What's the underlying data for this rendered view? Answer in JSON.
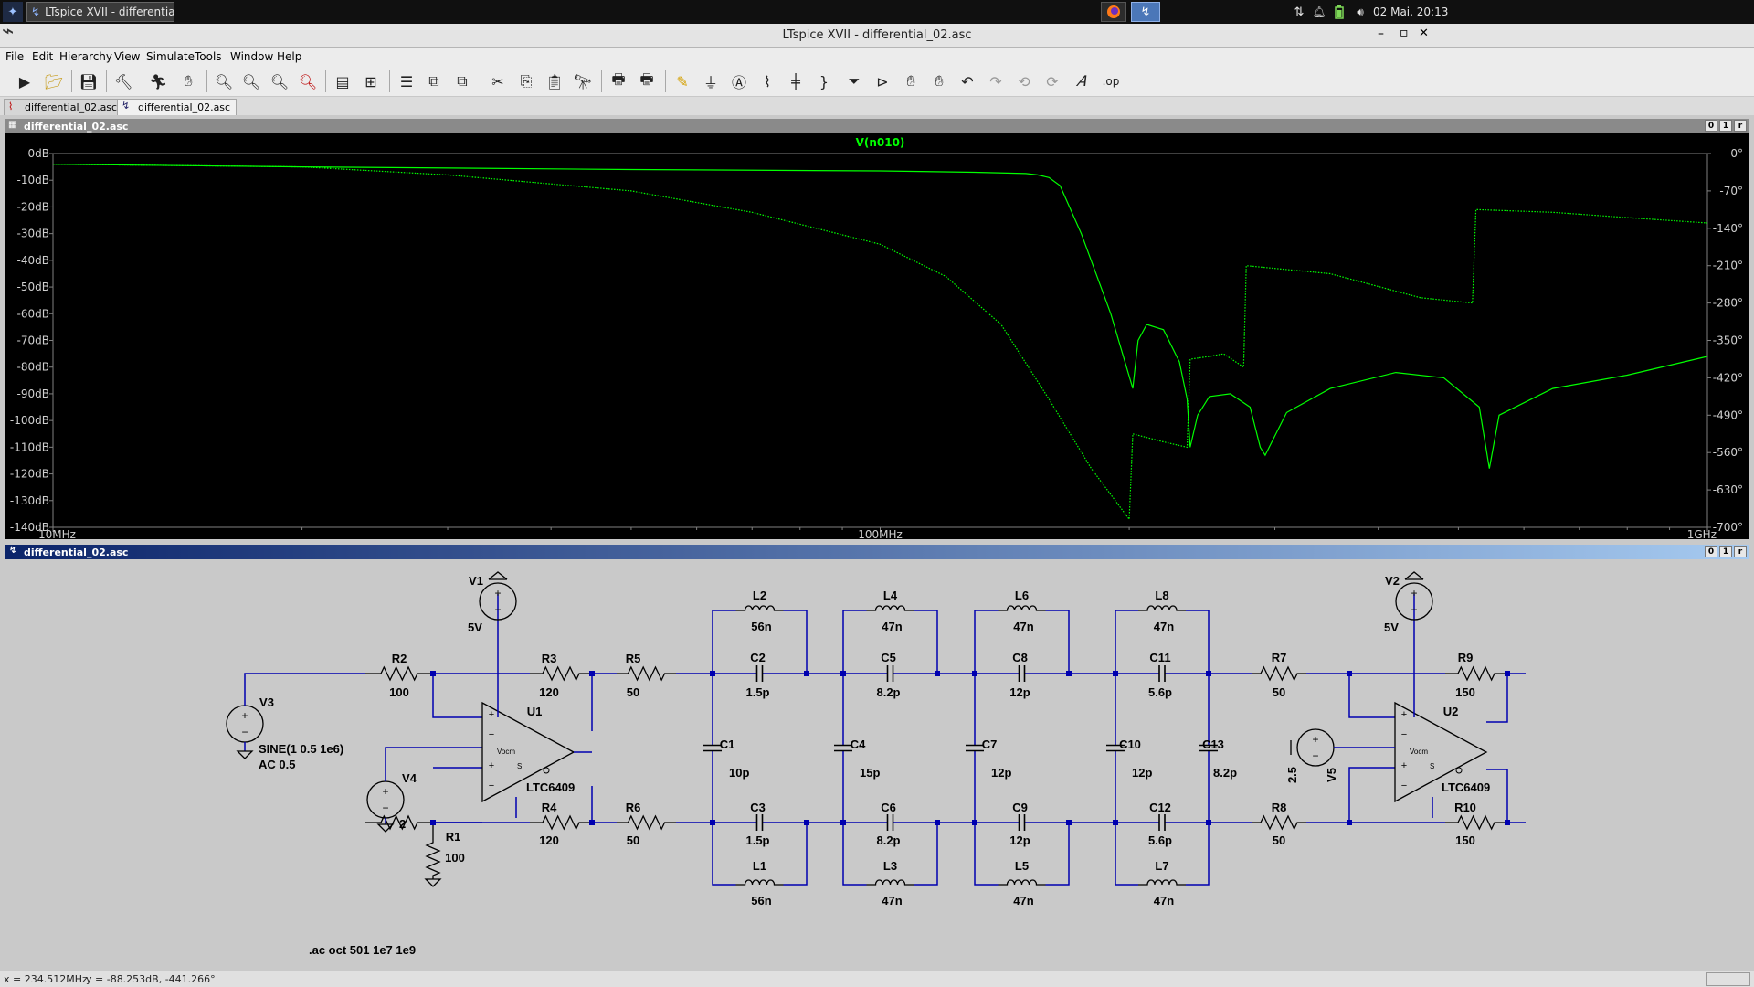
{
  "taskbar": {
    "task_title": "LTspice XVII - differential_02...",
    "clock": "02 Mai, 20:13"
  },
  "window": {
    "title": "LTspice XVII - differential_02.asc",
    "minimize": "–",
    "maximize": "▫",
    "close": "✕"
  },
  "menu": {
    "items": [
      "File",
      "Edit",
      "Hierarchy",
      "View",
      "Simulate",
      "Tools",
      "Window",
      "Help"
    ]
  },
  "tabs": [
    {
      "label": "differential_02.asc"
    },
    {
      "label": "differential_02.asc"
    }
  ],
  "plot_window": {
    "title": "differential_02.asc",
    "trace_name": "V(n010)",
    "colors": {
      "background": "#000000",
      "trace": "#00ff00",
      "axis": "#808080"
    }
  },
  "schematic_window": {
    "title": "differential_02.asc",
    "sim_directive": ".ac oct 501 1e7 1e9",
    "wire_color": "#0000b0",
    "components": [
      {
        "ref": "V1",
        "value": "5V"
      },
      {
        "ref": "V2",
        "value": "5V"
      },
      {
        "ref": "V3",
        "value": "SINE(1 0.5 1e6)",
        "value2": "AC 0.5"
      },
      {
        "ref": "V4",
        "value": "2"
      },
      {
        "ref": "V5",
        "value": "2.5"
      },
      {
        "ref": "U1",
        "value": "LTC6409"
      },
      {
        "ref": "U2",
        "value": "LTC6409"
      },
      {
        "ref": "R1",
        "value": "100"
      },
      {
        "ref": "R2",
        "value": "100"
      },
      {
        "ref": "R3",
        "value": "120"
      },
      {
        "ref": "R4",
        "value": "120"
      },
      {
        "ref": "R5",
        "value": "50"
      },
      {
        "ref": "R6",
        "value": "50"
      },
      {
        "ref": "R7",
        "value": "50"
      },
      {
        "ref": "R8",
        "value": "50"
      },
      {
        "ref": "R9",
        "value": "150"
      },
      {
        "ref": "R10",
        "value": "150"
      },
      {
        "ref": "L1",
        "value": "56n"
      },
      {
        "ref": "L2",
        "value": "56n"
      },
      {
        "ref": "L3",
        "value": "47n"
      },
      {
        "ref": "L4",
        "value": "47n"
      },
      {
        "ref": "L5",
        "value": "47n"
      },
      {
        "ref": "L6",
        "value": "47n"
      },
      {
        "ref": "L7",
        "value": "47n"
      },
      {
        "ref": "L8",
        "value": "47n"
      },
      {
        "ref": "C1",
        "value": "10p"
      },
      {
        "ref": "C2",
        "value": "1.5p"
      },
      {
        "ref": "C3",
        "value": "1.5p"
      },
      {
        "ref": "C4",
        "value": "15p"
      },
      {
        "ref": "C5",
        "value": "8.2p"
      },
      {
        "ref": "C6",
        "value": "8.2p"
      },
      {
        "ref": "C7",
        "value": "12p"
      },
      {
        "ref": "C8",
        "value": "12p"
      },
      {
        "ref": "C9",
        "value": "12p"
      },
      {
        "ref": "C10",
        "value": "12p"
      },
      {
        "ref": "C11",
        "value": "5.6p"
      },
      {
        "ref": "C12",
        "value": "5.6p"
      },
      {
        "ref": "C13",
        "value": "8.2p"
      }
    ]
  },
  "status": {
    "x_readout": "x = 234.512MHz",
    "y_readout": "y = -88.253dB, -441.266°"
  },
  "chart_data": {
    "type": "line",
    "title": "V(n010)",
    "x_scale": "log",
    "xlim": [
      10000000,
      1000000000
    ],
    "x_ticks": [
      "10MHz",
      "100MHz",
      "1GHz"
    ],
    "ylim_left": [
      -140,
      0
    ],
    "y_ticks_left": [
      "0dB",
      "-10dB",
      "-20dB",
      "-30dB",
      "-40dB",
      "-50dB",
      "-60dB",
      "-70dB",
      "-80dB",
      "-90dB",
      "-100dB",
      "-110dB",
      "-120dB",
      "-130dB",
      "-140dB"
    ],
    "ylim_right": [
      -700,
      0
    ],
    "y_ticks_right": [
      "0°",
      "-70°",
      "-140°",
      "-210°",
      "-280°",
      "-350°",
      "-420°",
      "-490°",
      "-560°",
      "-630°",
      "-700°"
    ],
    "grid": false,
    "series": [
      {
        "name": "V(n010) magnitude",
        "axis": "left",
        "style": "solid",
        "x": [
          10000000.0,
          20000000.0,
          50000000.0,
          100000000.0,
          130000000.0,
          150000000.0,
          155000000.0,
          160000000.0,
          165000000.0,
          175000000.0,
          190000000.0,
          202000000.0,
          205000000.0,
          210000000.0,
          220000000.0,
          230000000.0,
          235000000.0,
          237000000.0,
          242000000.0,
          250000000.0,
          265000000.0,
          280000000.0,
          288000000.0,
          292000000.0,
          310000000.0,
          350000000.0,
          420000000.0,
          480000000.0,
          530000000.0,
          545000000.0,
          560000000.0,
          650000000.0,
          800000000.0,
          1000000000.0
        ],
        "y": [
          -4,
          -5,
          -6,
          -6.5,
          -7,
          -7.5,
          -8,
          -9,
          -12,
          -30,
          -60,
          -88,
          -70,
          -64,
          -66,
          -78,
          -92,
          -110,
          -98,
          -91,
          -90,
          -95,
          -110,
          -113,
          -97,
          -88,
          -82,
          -84,
          -95,
          -118,
          -98,
          -88,
          -83,
          -76
        ]
      },
      {
        "name": "V(n010) phase",
        "axis": "right",
        "style": "dotted",
        "x": [
          10000000.0,
          20000000.0,
          30000000.0,
          50000000.0,
          70000000.0,
          100000000.0,
          120000000.0,
          140000000.0,
          160000000.0,
          180000000.0,
          200000000.0,
          202000000.0,
          220000000.0,
          235000000.0,
          237000000.0,
          250000000.0,
          260000000.0,
          275000000.0,
          277000000.0,
          350000000.0,
          450000000.0,
          520000000.0,
          525000000.0,
          650000000.0,
          800000000.0,
          1000000000.0
        ],
        "y": [
          -20,
          -25,
          -40,
          -70,
          -110,
          -170,
          -230,
          -320,
          -460,
          -590,
          -685,
          -525,
          -540,
          -550,
          -385,
          -380,
          -375,
          -400,
          -210,
          -225,
          -270,
          -280,
          -105,
          -110,
          -120,
          -130
        ]
      }
    ]
  }
}
